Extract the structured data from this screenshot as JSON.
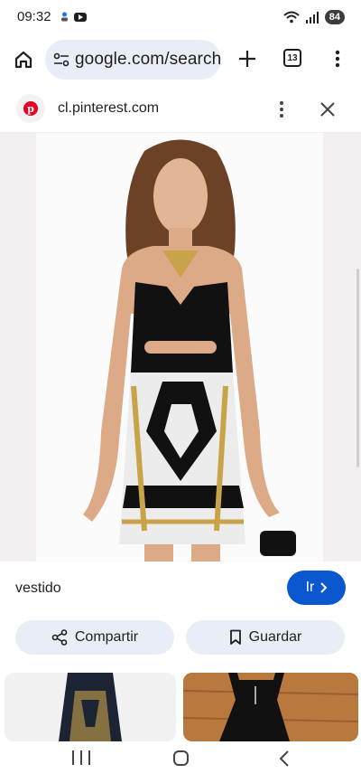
{
  "status_bar": {
    "time": "09:32",
    "battery": "84"
  },
  "browser": {
    "url": "google.com/search",
    "tab_count": "13"
  },
  "source": {
    "domain": "cl.pinterest.com"
  },
  "result": {
    "caption": "vestido",
    "go_label": "Ir",
    "share_label": "Compartir",
    "save_label": "Guardar"
  },
  "colors": {
    "accent": "#0b57d0",
    "pill": "#e9eef6",
    "pinterest": "#e60023"
  }
}
